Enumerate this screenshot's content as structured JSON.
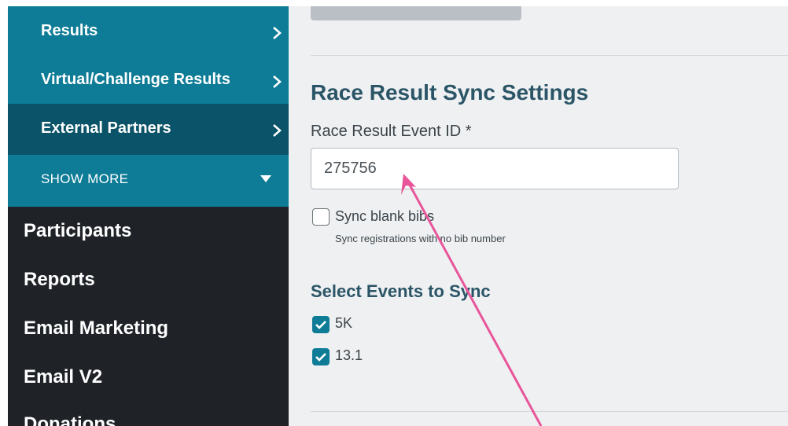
{
  "sidebar": {
    "sub_items": [
      {
        "label": "Results"
      },
      {
        "label": "Virtual/Challenge Results"
      },
      {
        "label": "External Partners"
      }
    ],
    "show_more": "SHOW  MORE",
    "nav_items": [
      {
        "label": "Participants"
      },
      {
        "label": "Reports"
      },
      {
        "label": "Email Marketing"
      },
      {
        "label": "Email V2"
      },
      {
        "label": "Donations"
      }
    ]
  },
  "main": {
    "section_title": "Race Result Sync Settings",
    "event_id_label": "Race Result Event ID *",
    "event_id_value": "275756",
    "sync_blank": {
      "label": "Sync blank bibs",
      "hint": "Sync registrations with no bib number"
    },
    "events_title": "Select Events to Sync",
    "events": [
      {
        "label": "5K"
      },
      {
        "label": "13.1"
      }
    ]
  },
  "colors": {
    "sidebar_bg": "#1f2328",
    "submenu_bg": "#0e7c96",
    "submenu_active_bg": "#0b5368",
    "content_bg": "#eef0f2",
    "accent": "#0e7c96",
    "annotation_arrow": "#e8559a"
  }
}
